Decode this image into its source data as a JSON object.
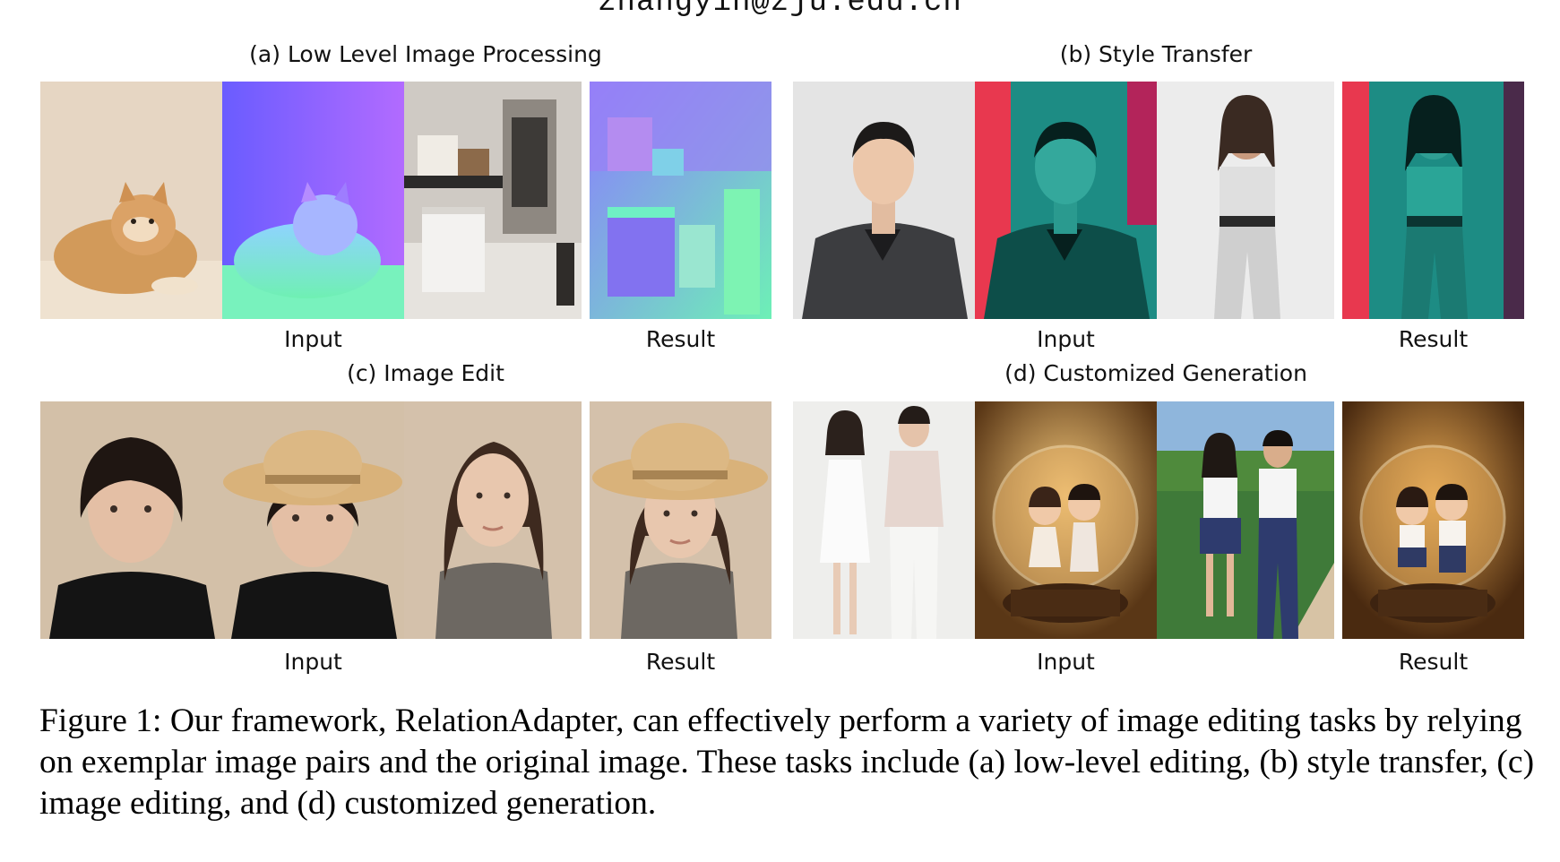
{
  "header_text": "zhangyih@zju.edu.cn",
  "panels": [
    {
      "title": "(a) Low Level Image Processing",
      "input_label": "Input",
      "result_label": "Result"
    },
    {
      "title": "(b) Style Transfer",
      "input_label": "Input",
      "result_label": "Result"
    },
    {
      "title": "(c) Image Edit",
      "input_label": "Input",
      "result_label": "Result"
    },
    {
      "title": "(d) Customized Generation",
      "input_label": "Input",
      "result_label": "Result"
    }
  ],
  "caption": "Figure 1: Our framework, RelationAdapter, can effectively perform a variety of image editing tasks by relying on exemplar image pairs and the original image. These tasks include (a) low-level editing, (b) style transfer, (c) image editing, and (d) customized generation.",
  "colors": {
    "normal_map_purple": "#8a6bff",
    "normal_map_green": "#5ef0a8",
    "style_teal": "#1e8a82",
    "style_red": "#e8384f"
  }
}
